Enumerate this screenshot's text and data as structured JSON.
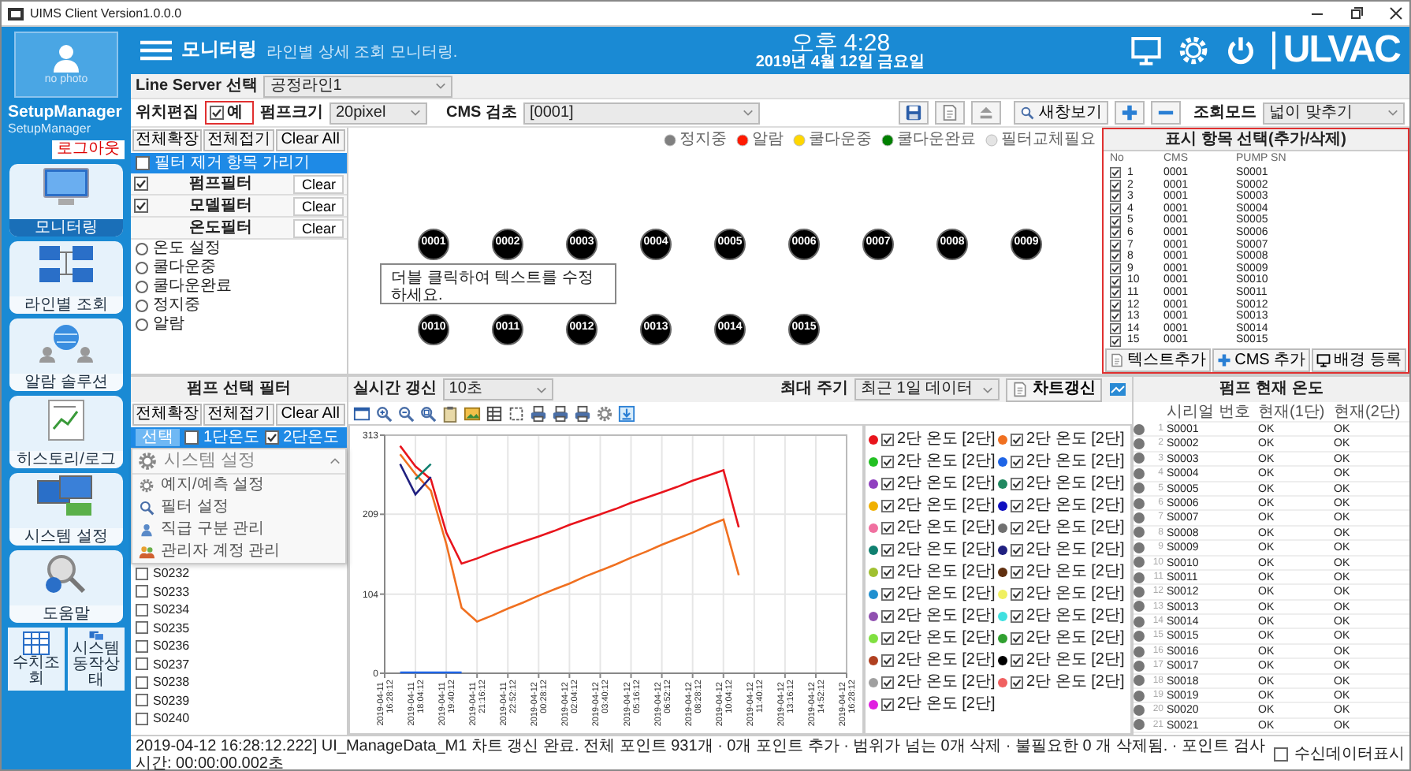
{
  "window": {
    "title": "UIMS Client Version1.0.0.0"
  },
  "user": {
    "photo_label": "no photo",
    "name": "SetupManager",
    "role": "SetupManager",
    "logout": "로그아웃"
  },
  "nav": [
    {
      "label": "모니터링",
      "selected": true
    },
    {
      "label": "라인별 조회",
      "selected": false
    },
    {
      "label": "알람 솔루션",
      "selected": false
    },
    {
      "label": "히스토리/로그",
      "selected": false
    },
    {
      "label": "시스템 설정",
      "selected": false
    },
    {
      "label": "도움말",
      "selected": false
    }
  ],
  "nav_small": [
    {
      "label": "수치조회"
    },
    {
      "label": "시스템 동작상태"
    }
  ],
  "header": {
    "title": "모니터링",
    "subtitle": "라인별 상세 조회 모니터링.",
    "time": "오후 4:28",
    "date": "2019년 4월 12일 금요일",
    "logo": "ULVAC"
  },
  "line_server": {
    "label": "Line Server 선택",
    "value": "공정라인1"
  },
  "toolbar": {
    "edit_label": "위치편집",
    "edit_checked": true,
    "edit_value": "예",
    "size_label": "펌프크기",
    "size_value": "20pixel",
    "cms_label": "CMS 검초",
    "cms_value": "[0001]",
    "view_button": "새창보기",
    "mode_label": "조회모드",
    "mode_value": "넓이 맞추기"
  },
  "filter_panel": {
    "buttons": [
      "전체확장",
      "전체접기",
      "Clear All"
    ],
    "hide_label": "필터 제거 항목 가리기",
    "hide_checked": false,
    "filters": [
      {
        "kind": "check",
        "label": "펌프필터",
        "checked": true,
        "clear": "Clear"
      },
      {
        "kind": "check",
        "label": "모델필터",
        "checked": true,
        "clear": "Clear"
      },
      {
        "kind": "plain",
        "label": "온도필터",
        "clear": "Clear"
      }
    ],
    "options": [
      {
        "label": "온도 설정",
        "selected": false
      },
      {
        "label": "쿨다운중",
        "selected": false
      },
      {
        "label": "쿨다운완료",
        "selected": false
      },
      {
        "label": "정지중",
        "selected": false
      },
      {
        "label": "알람",
        "selected": false
      }
    ]
  },
  "legend": [
    {
      "label": "정지중",
      "color": "#808080"
    },
    {
      "label": "알람",
      "color": "#ff1a00"
    },
    {
      "label": "쿨다운중",
      "color": "#ffd700"
    },
    {
      "label": "쿨다운완료",
      "color": "#008000"
    },
    {
      "label": "필터교체필요",
      "color": "#e4e4e4"
    }
  ],
  "nodes": [
    [
      "0001",
      "0002",
      "0003",
      "0004",
      "0005",
      "0006",
      "0007",
      "0008",
      "0009"
    ],
    [
      "0010",
      "0011",
      "0012",
      "0013",
      "0014",
      "0015"
    ]
  ],
  "text_note": "더블 클릭하여 텍스트를 수정하세요.",
  "display_panel": {
    "title": "표시 항목 선택(추가/삭제)",
    "columns": [
      "No",
      "CMS",
      "PUMP SN"
    ],
    "rows": [
      {
        "no": "1",
        "cms": "0001",
        "sn": "S0001",
        "checked": true
      },
      {
        "no": "2",
        "cms": "0001",
        "sn": "S0002",
        "checked": true
      },
      {
        "no": "3",
        "cms": "0001",
        "sn": "S0003",
        "checked": true
      },
      {
        "no": "4",
        "cms": "0001",
        "sn": "S0004",
        "checked": true
      },
      {
        "no": "5",
        "cms": "0001",
        "sn": "S0005",
        "checked": true
      },
      {
        "no": "6",
        "cms": "0001",
        "sn": "S0006",
        "checked": true
      },
      {
        "no": "7",
        "cms": "0001",
        "sn": "S0007",
        "checked": true
      },
      {
        "no": "8",
        "cms": "0001",
        "sn": "S0008",
        "checked": true
      },
      {
        "no": "9",
        "cms": "0001",
        "sn": "S0009",
        "checked": true
      },
      {
        "no": "10",
        "cms": "0001",
        "sn": "S0010",
        "checked": true
      },
      {
        "no": "11",
        "cms": "0001",
        "sn": "S0011",
        "checked": true
      },
      {
        "no": "12",
        "cms": "0001",
        "sn": "S0012",
        "checked": true
      },
      {
        "no": "13",
        "cms": "0001",
        "sn": "S0013",
        "checked": true
      },
      {
        "no": "14",
        "cms": "0001",
        "sn": "S0014",
        "checked": true
      },
      {
        "no": "15",
        "cms": "0001",
        "sn": "S0015",
        "checked": true
      }
    ],
    "buttons": [
      "텍스트추가",
      "CMS 추가",
      "배경 등록"
    ]
  },
  "pump_filter": {
    "title": "펌프 선택 필터",
    "buttons": [
      "전체확장",
      "전체접기",
      "Clear All"
    ],
    "select_tab": "선택",
    "columns": [
      {
        "label": "1단온도",
        "checked": false
      },
      {
        "label": "2단온도",
        "checked": true
      }
    ],
    "pumps": [
      {
        "label": "S0232",
        "checked": false
      },
      {
        "label": "S0233",
        "checked": false
      },
      {
        "label": "S0234",
        "checked": false
      },
      {
        "label": "S0235",
        "checked": false
      },
      {
        "label": "S0236",
        "checked": false
      },
      {
        "label": "S0237",
        "checked": false
      },
      {
        "label": "S0238",
        "checked": false
      },
      {
        "label": "S0239",
        "checked": false
      },
      {
        "label": "S0240",
        "checked": false
      }
    ]
  },
  "menu": {
    "title": "시스템 설정",
    "items": [
      "예지/예측 설정",
      "필터 설정",
      "직급 구분 관리",
      "관리자 계정 관리"
    ]
  },
  "chart_panel": {
    "refresh_label": "실시간 갱신",
    "refresh_value": "10초",
    "period_label": "최대 주기",
    "period_value": "최근 1일 데이터",
    "refresh_button": "차트갱신",
    "chart_data": {
      "type": "line",
      "grid": true,
      "ylim": [
        0,
        313
      ],
      "yticks": [
        0,
        104,
        209,
        313
      ],
      "categories": [
        "2019-04-11 16:28:12",
        null,
        "2019-04-11 18:04:12",
        null,
        "2019-04-11 19:40:12",
        null,
        "2019-04-11 21:16:12",
        null,
        "2019-04-11 22:52:12",
        null,
        "2019-04-12 00:28:12",
        null,
        "2019-04-12 02:04:12",
        null,
        "2019-04-12 03:40:12",
        null,
        "2019-04-12 05:16:12",
        null,
        "2019-04-12 06:52:12",
        null,
        "2019-04-12 08:28:12",
        null,
        "2019-04-12 10:04:12",
        null,
        "2019-04-12 11:40:12",
        null,
        "2019-04-12 13:16:12",
        null,
        "2019-04-12 14:52:12",
        null,
        "2019-04-12 16:28:12"
      ],
      "series": [
        {
          "color": "#e8141c",
          "values": [
            null,
            299,
            272,
            255,
            185,
            144,
            151,
            159,
            166,
            173,
            180,
            187,
            195,
            202,
            209,
            216,
            224,
            231,
            238,
            245,
            253,
            260,
            267,
            192,
            null,
            null,
            null,
            null,
            null,
            null,
            null
          ]
        },
        {
          "color": "#f07020",
          "values": [
            null,
            288,
            262,
            240,
            170,
            86,
            68,
            76,
            85,
            93,
            102,
            110,
            118,
            127,
            135,
            143,
            152,
            160,
            169,
            177,
            185,
            194,
            202,
            129,
            null,
            null,
            null,
            null,
            null,
            null,
            null
          ]
        },
        {
          "color": "#202080",
          "values": [
            null,
            275,
            235,
            258,
            null,
            null,
            null,
            null,
            null,
            null,
            null,
            null,
            null,
            null,
            null,
            null,
            null,
            null,
            null,
            null,
            null,
            null,
            null,
            null,
            null,
            null,
            null,
            null,
            null,
            null,
            null
          ]
        },
        {
          "color": "#108070",
          "values": [
            null,
            null,
            255,
            275,
            null,
            null,
            null,
            null,
            null,
            null,
            null,
            null,
            null,
            null,
            null,
            null,
            null,
            null,
            null,
            null,
            null,
            null,
            null,
            null,
            null,
            null,
            null,
            null,
            null,
            null,
            null
          ]
        },
        {
          "color": "#1e64e6",
          "values": [
            null,
            1,
            1,
            1,
            1,
            1,
            null,
            null,
            null,
            null,
            null,
            null,
            null,
            null,
            null,
            null,
            null,
            null,
            null,
            null,
            null,
            null,
            null,
            null,
            null,
            null,
            null,
            null,
            null,
            null,
            null
          ]
        }
      ]
    },
    "legend": [
      {
        "label": "2단 온도 [2단]",
        "checked": true,
        "color": "#e8141c"
      },
      {
        "label": "2단 온도 [2단]",
        "checked": true,
        "color": "#f07020"
      },
      {
        "label": "2단 온도 [2단]",
        "checked": true,
        "color": "#22c022"
      },
      {
        "label": "2단 온도 [2단]",
        "checked": true,
        "color": "#1e64e6"
      },
      {
        "label": "2단 온도 [2단]",
        "checked": true,
        "color": "#9040c0"
      },
      {
        "label": "2단 온도 [2단]",
        "checked": true,
        "color": "#208860"
      },
      {
        "label": "2단 온도 [2단]",
        "checked": true,
        "color": "#f0b000"
      },
      {
        "label": "2단 온도 [2단]",
        "checked": true,
        "color": "#1010c0"
      },
      {
        "label": "2단 온도 [2단]",
        "checked": true,
        "color": "#f070a0"
      },
      {
        "label": "2단 온도 [2단]",
        "checked": true,
        "color": "#707070"
      },
      {
        "label": "2단 온도 [2단]",
        "checked": true,
        "color": "#108070"
      },
      {
        "label": "2단 온도 [2단]",
        "checked": true,
        "color": "#202080"
      },
      {
        "label": "2단 온도 [2단]",
        "checked": true,
        "color": "#a0c030"
      },
      {
        "label": "2단 온도 [2단]",
        "checked": true,
        "color": "#603010"
      },
      {
        "label": "2단 온도 [2단]",
        "checked": true,
        "color": "#2090d0"
      },
      {
        "label": "2단 온도 [2단]",
        "checked": true,
        "color": "#f0f060"
      },
      {
        "label": "2단 온도 [2단]",
        "checked": true,
        "color": "#9050b0"
      },
      {
        "label": "2단 온도 [2단]",
        "checked": true,
        "color": "#40e0e0"
      },
      {
        "label": "2단 온도 [2단]",
        "checked": true,
        "color": "#80e040"
      },
      {
        "label": "2단 온도 [2단]",
        "checked": true,
        "color": "#30a030"
      },
      {
        "label": "2단 온도 [2단]",
        "checked": true,
        "color": "#b04020"
      },
      {
        "label": "2단 온도 [2단]",
        "checked": true,
        "color": "#000000"
      },
      {
        "label": "2단 온도 [2단]",
        "checked": true,
        "color": "#a0a0a0"
      },
      {
        "label": "2단 온도 [2단]",
        "checked": true,
        "color": "#f06060"
      },
      {
        "label": "2단 온도 [2단]",
        "checked": true,
        "color": "#e020e0"
      }
    ]
  },
  "temp_panel": {
    "title": "펌프 현재 온도",
    "columns": [
      "시리얼 번호",
      "현재(1단)",
      "현재(2단)"
    ],
    "rows": [
      {
        "no": "1",
        "serial": "S0001",
        "t1": "OK",
        "t2": "OK"
      },
      {
        "no": "2",
        "serial": "S0002",
        "t1": "OK",
        "t2": "OK"
      },
      {
        "no": "3",
        "serial": "S0003",
        "t1": "OK",
        "t2": "OK"
      },
      {
        "no": "4",
        "serial": "S0004",
        "t1": "OK",
        "t2": "OK"
      },
      {
        "no": "5",
        "serial": "S0005",
        "t1": "OK",
        "t2": "OK"
      },
      {
        "no": "6",
        "serial": "S0006",
        "t1": "OK",
        "t2": "OK"
      },
      {
        "no": "7",
        "serial": "S0007",
        "t1": "OK",
        "t2": "OK"
      },
      {
        "no": "8",
        "serial": "S0008",
        "t1": "OK",
        "t2": "OK"
      },
      {
        "no": "9",
        "serial": "S0009",
        "t1": "OK",
        "t2": "OK"
      },
      {
        "no": "10",
        "serial": "S0010",
        "t1": "OK",
        "t2": "OK"
      },
      {
        "no": "11",
        "serial": "S0011",
        "t1": "OK",
        "t2": "OK"
      },
      {
        "no": "12",
        "serial": "S0012",
        "t1": "OK",
        "t2": "OK"
      },
      {
        "no": "13",
        "serial": "S0013",
        "t1": "OK",
        "t2": "OK"
      },
      {
        "no": "14",
        "serial": "S0014",
        "t1": "OK",
        "t2": "OK"
      },
      {
        "no": "15",
        "serial": "S0015",
        "t1": "OK",
        "t2": "OK"
      },
      {
        "no": "16",
        "serial": "S0016",
        "t1": "OK",
        "t2": "OK"
      },
      {
        "no": "17",
        "serial": "S0017",
        "t1": "OK",
        "t2": "OK"
      },
      {
        "no": "18",
        "serial": "S0018",
        "t1": "OK",
        "t2": "OK"
      },
      {
        "no": "19",
        "serial": "S0019",
        "t1": "OK",
        "t2": "OK"
      },
      {
        "no": "20",
        "serial": "S0020",
        "t1": "OK",
        "t2": "OK"
      },
      {
        "no": "21",
        "serial": "S0021",
        "t1": "OK",
        "t2": "OK"
      }
    ]
  },
  "status_bar": {
    "message": "2019-04-12 16:28:12.222] UI_ManageData_M1 차트 갱신 완료. 전체 포인트 931개 · 0개 포인트 추가 · 범위가 넘는 0개 삭제 · 불필요한 0 개 삭제됨. · 포인트 검사 시간: 00:00:00.002초",
    "show_received_label": "수신데이터표시",
    "show_received_checked": false
  }
}
